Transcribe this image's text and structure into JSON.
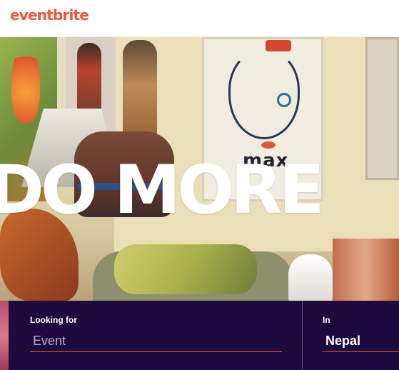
{
  "header": {
    "logo_text": "eventbrite",
    "logo_color": "#f05537"
  },
  "hero": {
    "headline": "DO MORE",
    "painting_text": "max"
  },
  "search": {
    "looking_for_label": "Looking for",
    "event_placeholder": "Event",
    "in_label": "In",
    "location_value": "Nepal",
    "background_color": "#1e0a3c",
    "underline_color": "#f05537"
  }
}
